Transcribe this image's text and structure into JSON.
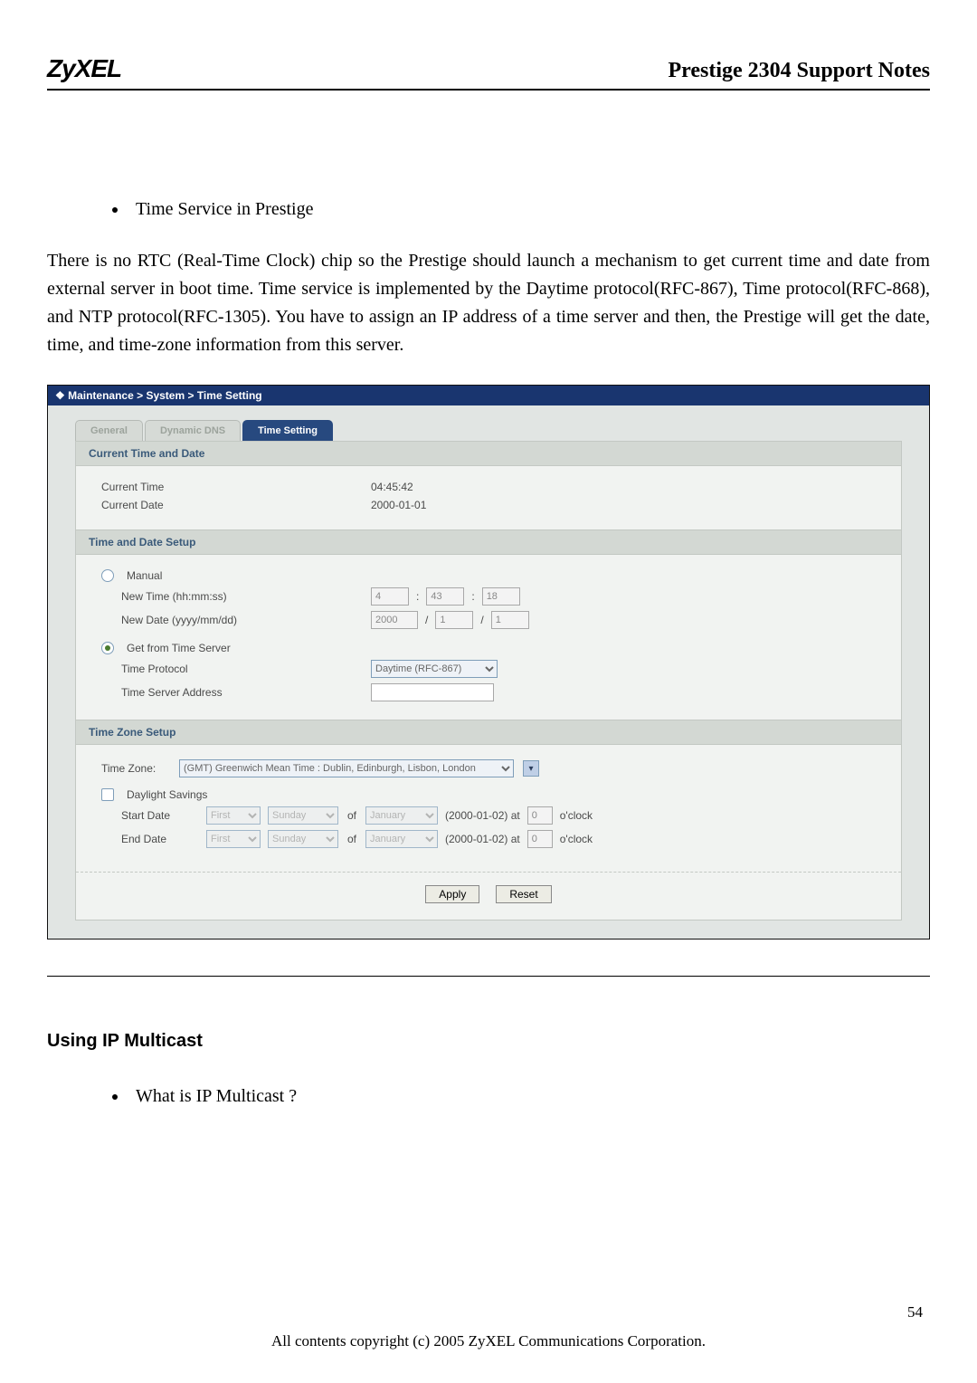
{
  "header": {
    "logo": "ZyXEL",
    "title": "Prestige 2304 Support Notes"
  },
  "intro": {
    "bullet": "Time Service in Prestige",
    "para_a": "There is no RTC (Real-Time Clock) chip so the Prestige should launch a mechanism to get current time and date from external server in boot time. Time service is implemented by the ",
    "b1": "Daytime protocol(RFC-867)",
    "sep1": ", ",
    "b2": "Time protocol(RFC-868)",
    "sep2": ", and ",
    "b3": "NTP protocol(RFC-1305)",
    "para_b": ". You have to assign an IP address of a time server and then, the Prestige will get the date, time, and time-zone information from this server."
  },
  "panel": {
    "breadcrumb": "Maintenance > System > Time Setting",
    "tabs": {
      "general": "General",
      "ddns": "Dynamic DNS",
      "time": "Time Setting"
    },
    "section1": {
      "title": "Current Time and Date",
      "cur_time_lbl": "Current Time",
      "cur_time_val": "04:45:42",
      "cur_date_lbl": "Current Date",
      "cur_date_val": "2000-01-01"
    },
    "section2": {
      "title": "Time and Date Setup",
      "manual": "Manual",
      "new_time_lbl": "New Time (hh:mm:ss)",
      "nt_h": "4",
      "nt_m": "43",
      "nt_s": "18",
      "new_date_lbl": "New Date (yyyy/mm/dd)",
      "nd_y": "2000",
      "nd_m": "1",
      "nd_d": "1",
      "from_server": "Get from Time Server",
      "proto_lbl": "Time Protocol",
      "proto_val": "Daytime (RFC-867)",
      "server_lbl": "Time Server Address",
      "server_val": ""
    },
    "section3": {
      "title": "Time Zone Setup",
      "tz_lbl": "Time Zone:",
      "tz_val": "(GMT) Greenwich Mean Time : Dublin, Edinburgh, Lisbon, London",
      "ds_chk": "Daylight Savings",
      "start_lbl": "Start Date",
      "end_lbl": "End Date",
      "ord": "First",
      "day": "Sunday",
      "of": "of",
      "month": "January",
      "date_paren": "(2000-01-02)  at",
      "hour": "0",
      "oclock": "o'clock"
    },
    "buttons": {
      "apply": "Apply",
      "reset": "Reset"
    }
  },
  "footer": {
    "h2": "Using IP Multicast",
    "bullet": "What is IP Multicast ?",
    "page": "54",
    "copy": "All contents copyright (c) 2005 ZyXEL Communications Corporation."
  }
}
